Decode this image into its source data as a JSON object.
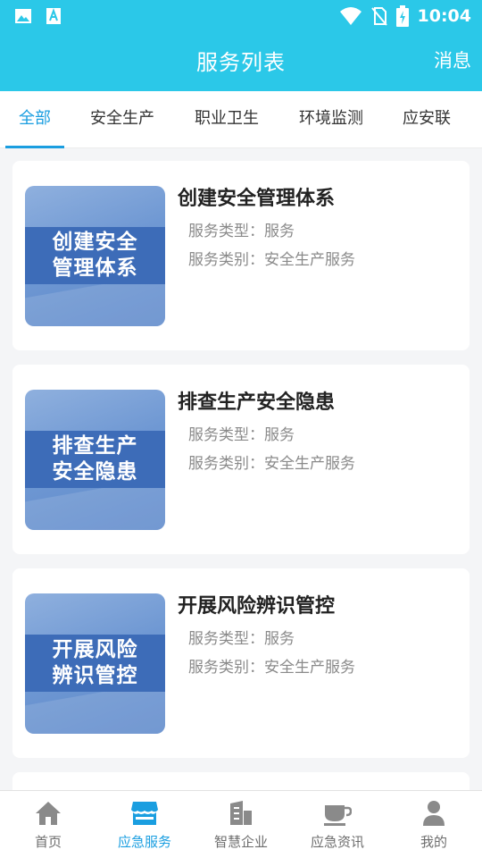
{
  "status_bar": {
    "time": "10:04",
    "icons": [
      "gallery-icon",
      "font-a-icon",
      "wifi-icon",
      "no-sim-icon",
      "battery-charging-icon"
    ]
  },
  "header": {
    "title": "服务列表",
    "message_label": "消息"
  },
  "tabs": [
    {
      "label": "全部",
      "active": true
    },
    {
      "label": "安全生产",
      "active": false
    },
    {
      "label": "职业卫生",
      "active": false
    },
    {
      "label": "环境监测",
      "active": false
    },
    {
      "label": "应安联",
      "active": false
    }
  ],
  "services": [
    {
      "title": "创建安全管理体系",
      "thumb_line1": "创建安全",
      "thumb_line2": "管理体系",
      "type": "服务类型：服务",
      "category": "服务类别：安全生产服务"
    },
    {
      "title": "排查生产安全隐患",
      "thumb_line1": "排查生产",
      "thumb_line2": "安全隐患",
      "type": "服务类型：服务",
      "category": "服务类别：安全生产服务"
    },
    {
      "title": "开展风险辨识管控",
      "thumb_line1": "开展风险",
      "thumb_line2": "辨识管控",
      "type": "服务类型：服务",
      "category": "服务类别：安全生产服务"
    }
  ],
  "bottom_nav": [
    {
      "label": "首页",
      "icon": "home-icon",
      "active": false
    },
    {
      "label": "应急服务",
      "icon": "store-icon",
      "active": true
    },
    {
      "label": "智慧企业",
      "icon": "building-icon",
      "active": false
    },
    {
      "label": "应急资讯",
      "icon": "cup-icon",
      "active": false
    },
    {
      "label": "我的",
      "icon": "user-icon",
      "active": false
    }
  ],
  "colors": {
    "header_bg": "#2bc8e8",
    "accent": "#1a9ee0",
    "page_bg": "#f4f5f7"
  }
}
